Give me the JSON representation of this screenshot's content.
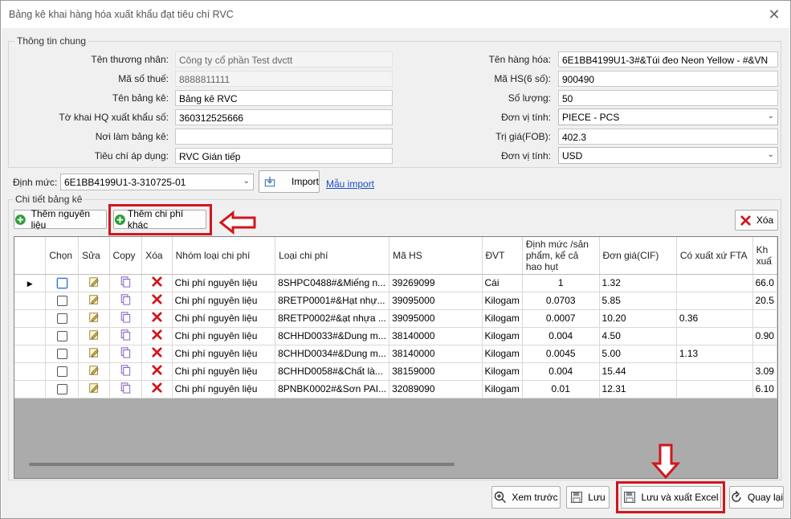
{
  "window": {
    "title": "Bảng kê khai hàng hóa xuất khẩu đạt tiêu chí RVC",
    "close_glyph": "✕"
  },
  "general": {
    "legend": "Thông tin chung",
    "ten_thuong_nhan": {
      "label": "Tên thương nhân:",
      "value": "Công ty cổ phần Test dvctt"
    },
    "ma_so_thue": {
      "label": "Mã số thuế:",
      "value": "8888811111"
    },
    "ten_bang_ke": {
      "label": "Tên bảng kê:",
      "value": "Bảng kê RVC"
    },
    "to_khai": {
      "label": "Tờ khai HQ xuất khẩu số:",
      "value": "360312525666"
    },
    "noi_lam": {
      "label": "Nơi làm bảng kê:",
      "value": ""
    },
    "tieu_chi": {
      "label": "Tiêu chí áp dụng:",
      "value": "RVC Gián tiếp"
    },
    "ten_hang_hoa": {
      "label": "Tên hàng hóa:",
      "value": "6E1BB4199U1-3#&Túi đeo   Neon Yellow - #&VN"
    },
    "ma_hs": {
      "label": "Mã HS(6 số):",
      "value": "900490"
    },
    "so_luong": {
      "label": "Số lượng:",
      "value": "50"
    },
    "don_vi_tinh_1": {
      "label": "Đơn vị tính:",
      "value": "PIECE - PCS"
    },
    "tri_gia": {
      "label": "Trị giá(FOB):",
      "value": "402.3"
    },
    "don_vi_tinh_2": {
      "label": "Đơn vị tính:",
      "value": "USD"
    }
  },
  "dinh_muc": {
    "label": "Định mức:",
    "value": "6E1BB4199U1-3-310725-01",
    "import_label": "Import",
    "mau_import": "Mẫu import"
  },
  "detail": {
    "legend": "Chi tiết bảng kê",
    "add_material": "Thêm nguyên liệu",
    "add_cost": "Thêm chi phí khác",
    "delete": "Xóa"
  },
  "table": {
    "headers": [
      "",
      "Chọn",
      "Sửa",
      "Copy",
      "Xóa",
      "Nhóm loại chi phí",
      "Loại chi phí",
      "Mã HS",
      "ĐVT",
      "Định mức /sản phẩm, kể cả hao hụt",
      "Đơn giá(CIF)",
      "Có xuất xứ FTA",
      "Kh xuấ"
    ],
    "rows": [
      {
        "nhom": "Chi phí nguyên liệu",
        "loai": "8SHPC0488#&Miếng n...",
        "mahs": "39269099",
        "dvt": "Cái",
        "dinhmuc": "1",
        "dongia": "1.32",
        "fta": "",
        "kh": "66.0"
      },
      {
        "nhom": "Chi phí nguyên liệu",
        "loai": "8RETP0001#&Hạt nhự...",
        "mahs": "39095000",
        "dvt": "Kilogam",
        "dinhmuc": "0.0703",
        "dongia": "5.85",
        "fta": "",
        "kh": "20.5"
      },
      {
        "nhom": "Chi phí nguyên liệu",
        "loai": "8RETP0002#&ạt nhựa ...",
        "mahs": "39095000",
        "dvt": "Kilogam",
        "dinhmuc": "0.0007",
        "dongia": "10.20",
        "fta": "0.36",
        "kh": ""
      },
      {
        "nhom": "Chi phí nguyên liệu",
        "loai": "8CHHD0033#&Dung m...",
        "mahs": "38140000",
        "dvt": "Kilogam",
        "dinhmuc": "0.004",
        "dongia": "4.50",
        "fta": "",
        "kh": "0.90"
      },
      {
        "nhom": "Chi phí nguyên liệu",
        "loai": "8CHHD0034#&Dung m...",
        "mahs": "38140000",
        "dvt": "Kilogam",
        "dinhmuc": "0.0045",
        "dongia": "5.00",
        "fta": "1.13",
        "kh": ""
      },
      {
        "nhom": "Chi phí nguyên liệu",
        "loai": "8CHHD0058#&Chất là...",
        "mahs": "38159000",
        "dvt": "Kilogam",
        "dinhmuc": "0.004",
        "dongia": "15.44",
        "fta": "",
        "kh": "3.09"
      },
      {
        "nhom": "Chi phí nguyên liệu",
        "loai": "8PNBK0002#&Sơn PAI...",
        "mahs": "32089090",
        "dvt": "Kilogam",
        "dinhmuc": "0.01",
        "dongia": "12.31",
        "fta": "",
        "kh": "6.10"
      }
    ]
  },
  "footer": {
    "preview": "Xem trước",
    "save": "Lưu",
    "save_export": "Lưu và xuất Excel",
    "back": "Quay lại"
  },
  "colors": {
    "highlight_red": "#d2151d",
    "link_blue": "#1a4ec7",
    "add_green": "#2e9e3a",
    "delete_red": "#d2151d"
  }
}
